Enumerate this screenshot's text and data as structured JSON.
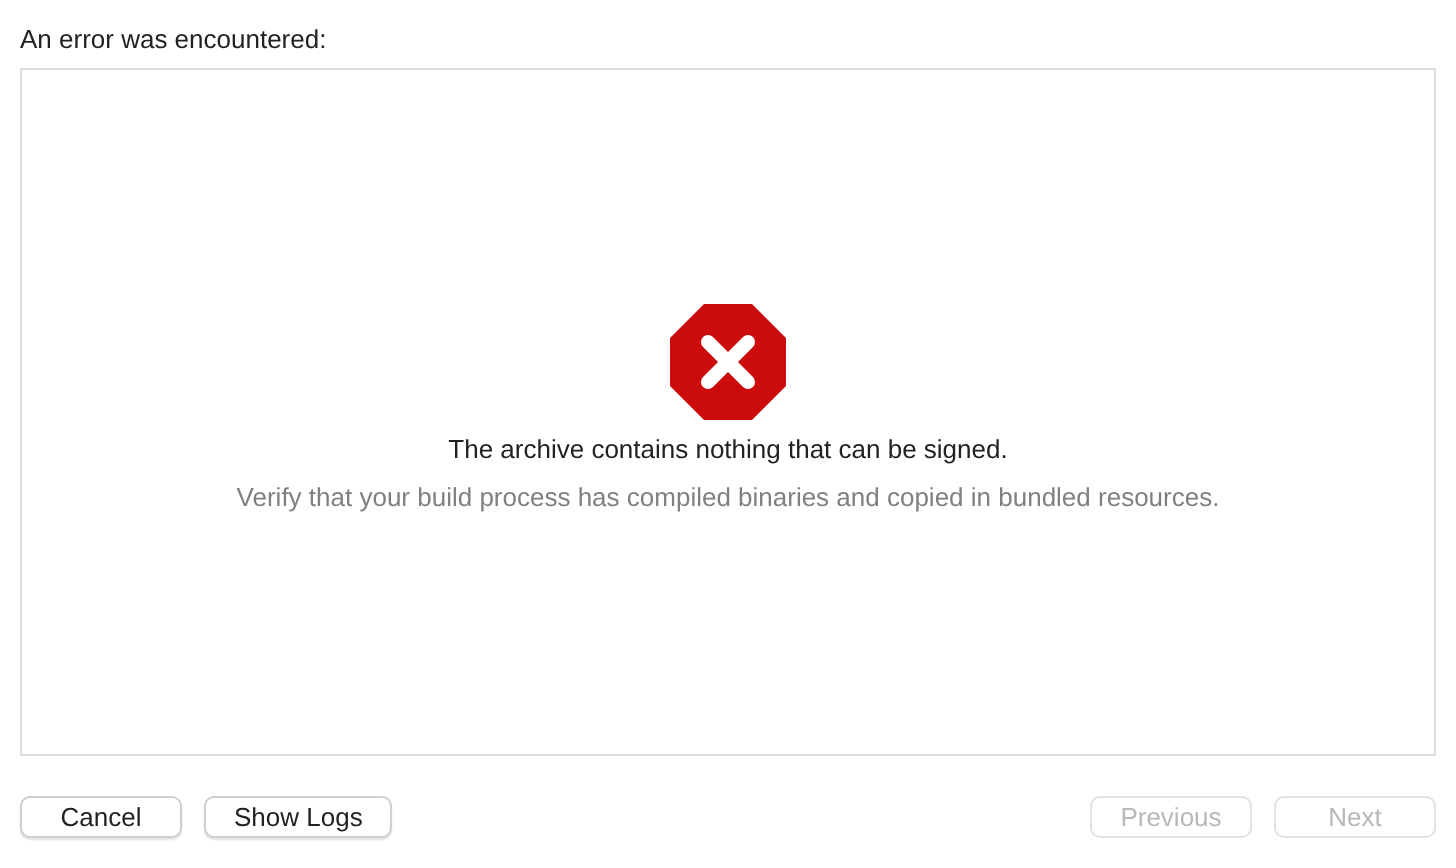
{
  "heading": "An error was encountered:",
  "message": {
    "title": "The archive contains nothing that can be signed.",
    "detail": "Verify that your build process has compiled binaries and copied in bundled resources."
  },
  "buttons_left": [
    {
      "label": "Cancel",
      "disabled": false
    },
    {
      "label": "Show Logs",
      "disabled": false
    }
  ],
  "buttons_right": [
    {
      "label": "Previous",
      "disabled": true
    },
    {
      "label": "Next",
      "disabled": true
    }
  ]
}
